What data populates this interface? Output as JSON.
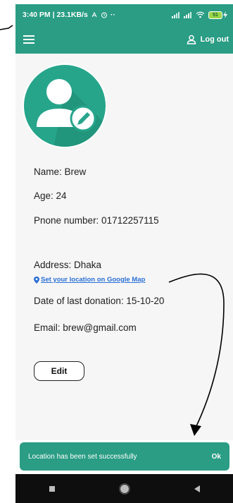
{
  "status_bar": {
    "left_text": "3:40 PM | 23.1KB/s",
    "dots": "··",
    "battery": "51"
  },
  "app_bar": {
    "menu_icon": "hamburger-menu-icon",
    "logout_icon": "person-icon",
    "logout_label": "Log out"
  },
  "profile": {
    "avatar_icon": "user-edit-icon",
    "name": "Name: Brew",
    "age": "Age: 24",
    "phone": "Pnone number: 01712257115",
    "address": "Address: Dhaka",
    "map_link": "Set your location on Google Map",
    "map_link_icon": "location-pin-icon",
    "last_donation": "Date of last donation: 15-10-20",
    "email": "Email: brew@gmail.com",
    "edit_label": "Edit"
  },
  "snackbar": {
    "message": "Location has been set successfully",
    "action": "Ok"
  },
  "nav_bar": {
    "recents_icon": "square-icon",
    "home_icon": "circle-icon",
    "back_icon": "triangle-back-icon"
  },
  "colors": {
    "primary": "#2a9d84",
    "avatar_bg": "#26a58b",
    "link": "#2a6fd6",
    "background": "#f6f6f6"
  }
}
